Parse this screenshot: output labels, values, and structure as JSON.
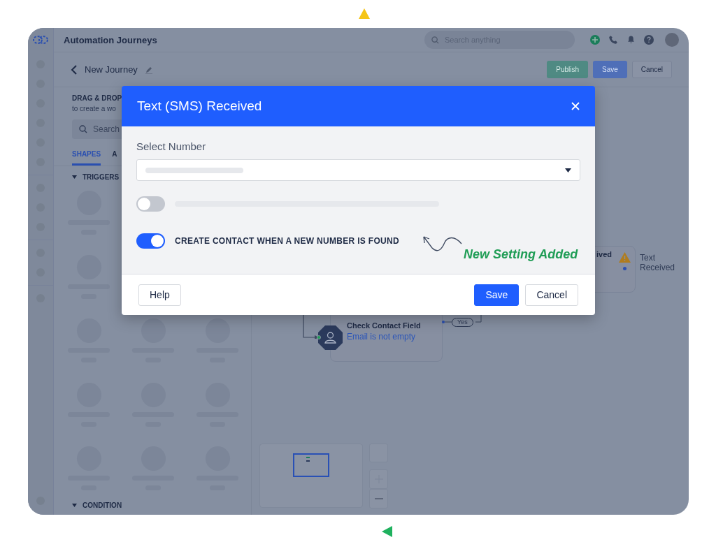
{
  "app": {
    "title": "Automation Journeys",
    "search": {
      "placeholder": "Search anything"
    }
  },
  "journey": {
    "title": "New Journey",
    "buttons": [
      {
        "label": "Publish",
        "kind": "publish"
      },
      {
        "label": "Save",
        "kind": "primary"
      },
      {
        "label": "Cancel",
        "kind": "secondary"
      }
    ]
  },
  "sidebar": {
    "heading": "DRAG & DROP",
    "subtitle": "to create a wo",
    "search": {
      "placeholder": "Search"
    },
    "tabs": [
      {
        "label": "SHAPES",
        "selected": true
      },
      {
        "label": "A",
        "selected": false
      }
    ],
    "sections": [
      {
        "label": "TRIGGERS",
        "expanded": true
      },
      {
        "label": "CONDITION",
        "expanded": true
      }
    ]
  },
  "canvas": {
    "trigger_node": {
      "title": "ived",
      "side_label": "Text Received"
    },
    "condition_node": {
      "title": "Check Contact Field",
      "subtitle": "Email is not empty"
    },
    "branch_label": "Yes"
  },
  "modal": {
    "title": "Text (SMS) Received",
    "field_label": "Select Number",
    "toggles": [
      {
        "on": false
      },
      {
        "on": true,
        "label": "CREATE CONTACT WHEN A NEW NUMBER IS FOUND"
      }
    ],
    "annotation": "New Setting Added",
    "buttons": [
      {
        "label": "Help",
        "kind": "secondary"
      },
      {
        "label": "Save",
        "kind": "primary"
      },
      {
        "label": "Cancel",
        "kind": "secondary"
      }
    ]
  }
}
